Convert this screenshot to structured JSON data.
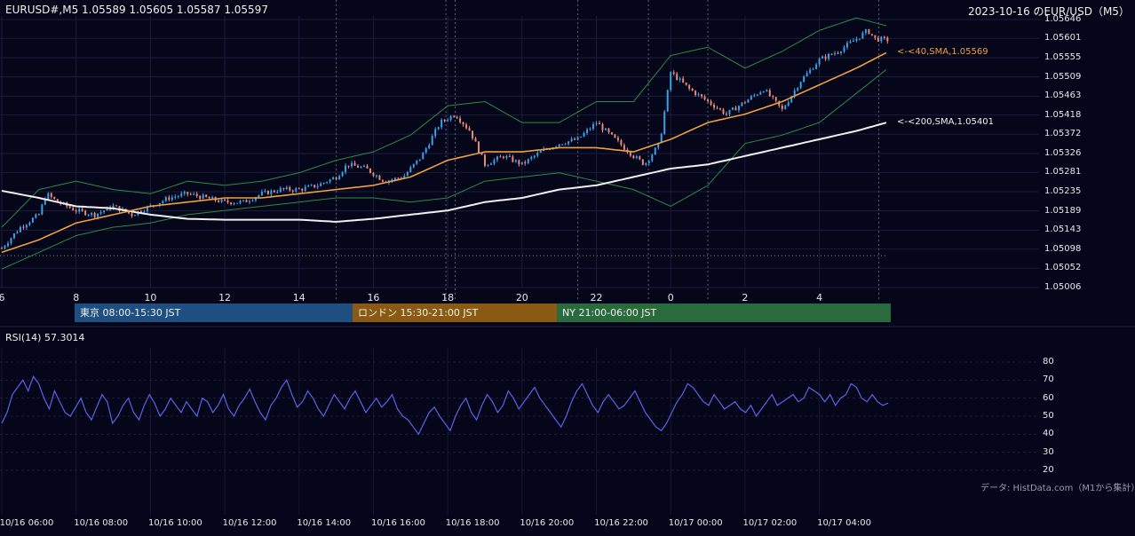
{
  "header": {
    "ohlc_text": "EURUSD#,M5 1.05589 1.05605 1.05587 1.05597",
    "title_right": "2023-10-16 のEUR/USD（M5）"
  },
  "sessions": [
    {
      "label": "東京 08:00-15:30 JST",
      "color": "#1f4e80"
    },
    {
      "label": "ロンドン 15:30-21:00 JST",
      "color": "#8a5a12"
    },
    {
      "label": "NY 21:00-06:00 JST",
      "color": "#2a6b3d"
    }
  ],
  "indicators": {
    "sma40_label": "<-<40,SMA,1.05569",
    "sma200_label": "<-<200,SMA,1.05401",
    "rsi_label": "RSI(14) 57.3014"
  },
  "credit": "データ: HistData.com（M1から集計）",
  "colors": {
    "background": "#05061a",
    "bull": "#3aa0e8",
    "bear": "#e88a7a",
    "sma40": "#f0a040",
    "sma200": "#f0f0f0",
    "bollinger": "#2e8a45",
    "rsi": "#5a64e8"
  },
  "chart_data": [
    {
      "type": "candlestick",
      "title": "",
      "price_ticks": [
        "1.05646",
        "1.05601",
        "1.05555",
        "1.05509",
        "1.05463",
        "1.05418",
        "1.05372",
        "1.05326",
        "1.05281",
        "1.05235",
        "1.05189",
        "1.05143",
        "1.05098",
        "1.05052",
        "1.05006"
      ],
      "ylim": [
        1.05006,
        1.05646
      ],
      "hour_ticks": [
        "6",
        "8",
        "10",
        "12",
        "14",
        "16",
        "18",
        "20",
        "22",
        "0",
        "2",
        "4"
      ],
      "x_time_ticks": [
        "10/16 06:00",
        "10/16 08:00",
        "10/16 10:00",
        "10/16 12:00",
        "10/16 14:00",
        "10/16 16:00",
        "10/16 18:00",
        "10/16 20:00",
        "10/16 22:00",
        "10/17 00:00",
        "10/17 02:00",
        "10/17 04:00"
      ],
      "x_range_hours": [
        6.0,
        29.85
      ],
      "close_path": [
        [
          6.0,
          1.051
        ],
        [
          6.5,
          1.0515
        ],
        [
          7.0,
          1.0518
        ],
        [
          7.2,
          1.0523
        ],
        [
          7.5,
          1.0521
        ],
        [
          8.0,
          1.0519
        ],
        [
          8.5,
          1.0518
        ],
        [
          9.0,
          1.052
        ],
        [
          9.5,
          1.0518
        ],
        [
          10.0,
          1.052
        ],
        [
          10.5,
          1.0522
        ],
        [
          11.0,
          1.0523
        ],
        [
          11.5,
          1.0522
        ],
        [
          12.0,
          1.0521
        ],
        [
          12.5,
          1.0521
        ],
        [
          13.0,
          1.0523
        ],
        [
          13.5,
          1.0524
        ],
        [
          14.0,
          1.0524
        ],
        [
          14.5,
          1.0525
        ],
        [
          15.0,
          1.0527
        ],
        [
          15.3,
          1.053
        ],
        [
          15.8,
          1.0529
        ],
        [
          16.3,
          1.0526
        ],
        [
          16.8,
          1.0527
        ],
        [
          17.3,
          1.0532
        ],
        [
          17.8,
          1.054
        ],
        [
          18.2,
          1.0542
        ],
        [
          18.6,
          1.0538
        ],
        [
          19.0,
          1.053
        ],
        [
          19.5,
          1.0532
        ],
        [
          20.0,
          1.053
        ],
        [
          20.5,
          1.0533
        ],
        [
          21.0,
          1.0535
        ],
        [
          21.5,
          1.0536
        ],
        [
          22.0,
          1.054
        ],
        [
          22.5,
          1.0536
        ],
        [
          23.0,
          1.0532
        ],
        [
          23.3,
          1.053
        ],
        [
          23.7,
          1.0535
        ],
        [
          24.0,
          1.0552
        ],
        [
          24.5,
          1.0548
        ],
        [
          25.0,
          1.0545
        ],
        [
          25.5,
          1.0542
        ],
        [
          26.0,
          1.0545
        ],
        [
          26.5,
          1.0548
        ],
        [
          27.0,
          1.0543
        ],
        [
          27.5,
          1.055
        ],
        [
          28.0,
          1.0555
        ],
        [
          28.5,
          1.0557
        ],
        [
          29.0,
          1.056
        ],
        [
          29.3,
          1.0562
        ],
        [
          29.5,
          1.056
        ],
        [
          29.85,
          1.05597
        ]
      ],
      "sma40_path": [
        [
          6.0,
          1.0509
        ],
        [
          7.0,
          1.0512
        ],
        [
          8.0,
          1.0516
        ],
        [
          9.0,
          1.0518
        ],
        [
          10.0,
          1.052
        ],
        [
          11.0,
          1.0521
        ],
        [
          12.0,
          1.0522
        ],
        [
          13.0,
          1.0522
        ],
        [
          14.0,
          1.0523
        ],
        [
          15.0,
          1.0524
        ],
        [
          16.0,
          1.0525
        ],
        [
          17.0,
          1.0527
        ],
        [
          18.0,
          1.0531
        ],
        [
          19.0,
          1.0533
        ],
        [
          20.0,
          1.0533
        ],
        [
          21.0,
          1.0534
        ],
        [
          22.0,
          1.0534
        ],
        [
          23.0,
          1.0533
        ],
        [
          24.0,
          1.0536
        ],
        [
          25.0,
          1.054
        ],
        [
          26.0,
          1.0542
        ],
        [
          27.0,
          1.0545
        ],
        [
          28.0,
          1.0549
        ],
        [
          29.0,
          1.0553
        ],
        [
          29.85,
          1.05569
        ]
      ],
      "sma200_path": [
        [
          6.0,
          1.05237
        ],
        [
          7.0,
          1.0522
        ],
        [
          8.0,
          1.052
        ],
        [
          9.0,
          1.05195
        ],
        [
          10.0,
          1.0518
        ],
        [
          11.0,
          1.0517
        ],
        [
          12.0,
          1.05168
        ],
        [
          13.0,
          1.05168
        ],
        [
          14.0,
          1.05168
        ],
        [
          15.0,
          1.05163
        ],
        [
          16.0,
          1.0517
        ],
        [
          17.0,
          1.0518
        ],
        [
          18.0,
          1.0519
        ],
        [
          19.0,
          1.0521
        ],
        [
          20.0,
          1.0522
        ],
        [
          21.0,
          1.0524
        ],
        [
          22.0,
          1.0525
        ],
        [
          23.0,
          1.0527
        ],
        [
          24.0,
          1.0529
        ],
        [
          25.0,
          1.053
        ],
        [
          26.0,
          1.0532
        ],
        [
          27.0,
          1.0534
        ],
        [
          28.0,
          1.0536
        ],
        [
          29.0,
          1.0538
        ],
        [
          29.85,
          1.05401
        ]
      ],
      "bollinger_upper": [
        [
          6.0,
          1.0515
        ],
        [
          7.0,
          1.0524
        ],
        [
          8.0,
          1.0526
        ],
        [
          9.0,
          1.0524
        ],
        [
          10.0,
          1.0523
        ],
        [
          11.0,
          1.0526
        ],
        [
          12.0,
          1.0525
        ],
        [
          13.0,
          1.0526
        ],
        [
          14.0,
          1.0528
        ],
        [
          15.0,
          1.0531
        ],
        [
          16.0,
          1.0533
        ],
        [
          17.0,
          1.0537
        ],
        [
          18.0,
          1.0544
        ],
        [
          19.0,
          1.0545
        ],
        [
          20.0,
          1.054
        ],
        [
          21.0,
          1.054
        ],
        [
          22.0,
          1.0545
        ],
        [
          23.0,
          1.0545
        ],
        [
          24.0,
          1.0556
        ],
        [
          25.0,
          1.0558
        ],
        [
          26.0,
          1.0553
        ],
        [
          27.0,
          1.0557
        ],
        [
          28.0,
          1.0562
        ],
        [
          29.0,
          1.0565
        ],
        [
          29.85,
          1.0563
        ]
      ],
      "bollinger_lower": [
        [
          6.0,
          1.0505
        ],
        [
          7.0,
          1.0509
        ],
        [
          8.0,
          1.0513
        ],
        [
          9.0,
          1.0515
        ],
        [
          10.0,
          1.0516
        ],
        [
          11.0,
          1.0518
        ],
        [
          12.0,
          1.0519
        ],
        [
          13.0,
          1.052
        ],
        [
          14.0,
          1.0521
        ],
        [
          15.0,
          1.0522
        ],
        [
          16.0,
          1.0522
        ],
        [
          17.0,
          1.0521
        ],
        [
          18.0,
          1.0522
        ],
        [
          19.0,
          1.0526
        ],
        [
          20.0,
          1.0527
        ],
        [
          21.0,
          1.0528
        ],
        [
          22.0,
          1.0526
        ],
        [
          23.0,
          1.0524
        ],
        [
          24.0,
          1.052
        ],
        [
          25.0,
          1.0525
        ],
        [
          26.0,
          1.0535
        ],
        [
          27.0,
          1.0537
        ],
        [
          28.0,
          1.054
        ],
        [
          29.0,
          1.0547
        ],
        [
          29.85,
          1.0553
        ]
      ],
      "dotted_level": 1.05082,
      "session_vlines_hours": [
        15.0,
        17.95,
        18.2,
        21.5,
        23.4,
        25.0,
        29.6
      ]
    },
    {
      "type": "line",
      "title": "RSI(14) 57.3014",
      "ylim": [
        20,
        80
      ],
      "yticks": [
        "80",
        "70",
        "60",
        "50",
        "40",
        "30",
        "20"
      ],
      "x_range_hours": [
        6.0,
        29.85
      ],
      "values": [
        46,
        52,
        62,
        66,
        70,
        64,
        72,
        68,
        60,
        54,
        64,
        58,
        52,
        50,
        55,
        60,
        52,
        48,
        55,
        62,
        58,
        46,
        50,
        56,
        60,
        52,
        48,
        56,
        62,
        57,
        50,
        54,
        60,
        56,
        52,
        58,
        54,
        50,
        60,
        58,
        52,
        56,
        62,
        54,
        50,
        56,
        60,
        65,
        58,
        52,
        48,
        56,
        60,
        66,
        70,
        62,
        55,
        58,
        64,
        60,
        54,
        50,
        56,
        62,
        58,
        54,
        60,
        64,
        58,
        52,
        56,
        60,
        55,
        58,
        62,
        54,
        50,
        48,
        44,
        40,
        46,
        52,
        55,
        50,
        46,
        42,
        50,
        56,
        60,
        52,
        48,
        56,
        62,
        58,
        52,
        56,
        64,
        60,
        54,
        58,
        62,
        66,
        60,
        56,
        52,
        48,
        44,
        50,
        58,
        64,
        68,
        62,
        56,
        52,
        58,
        62,
        58,
        54,
        56,
        60,
        64,
        58,
        52,
        48,
        44,
        42,
        46,
        52,
        58,
        62,
        68,
        66,
        62,
        58,
        56,
        62,
        58,
        54,
        56,
        58,
        54,
        52,
        56,
        50,
        54,
        58,
        62,
        56,
        58,
        60,
        62,
        58,
        60,
        66,
        64,
        62,
        58,
        62,
        56,
        60,
        62,
        68,
        66,
        60,
        58,
        62,
        58,
        56,
        57.3
      ]
    }
  ]
}
